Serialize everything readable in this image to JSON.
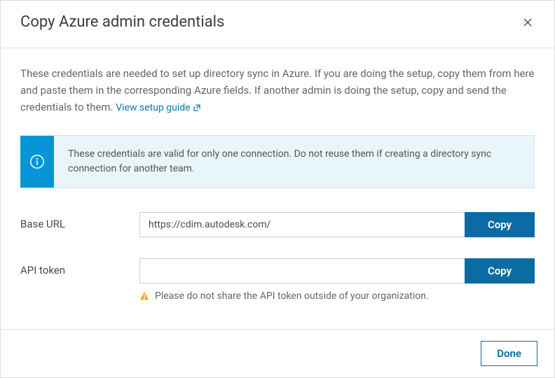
{
  "header": {
    "title": "Copy Azure admin credentials"
  },
  "intro": {
    "text": "These credentials are needed to set up directory sync in Azure. If you are doing the setup, copy them from here and paste them in the corresponding Azure fields. If another admin is doing the setup, copy and send the credentials to them. ",
    "link_label": "View setup guide"
  },
  "banner": {
    "text": "These credentials are valid for only one connection. Do not reuse them if creating a directory sync connection for another team."
  },
  "fields": {
    "base_url": {
      "label": "Base URL",
      "value": "https://cdim.autodesk.com/",
      "copy_label": "Copy"
    },
    "api_token": {
      "label": "API token",
      "value": "",
      "copy_label": "Copy",
      "warning": "Please do not share the API token outside of your organization."
    }
  },
  "footer": {
    "done_label": "Done"
  }
}
